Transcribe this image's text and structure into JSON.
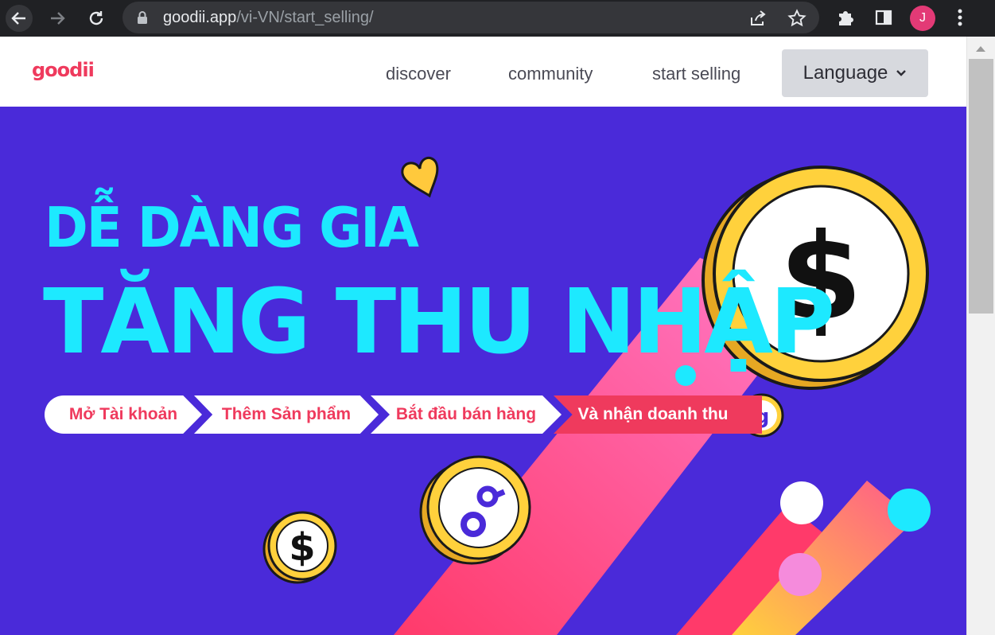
{
  "browser": {
    "url_domain": "goodii.app",
    "url_path": "/vi-VN/start_selling/",
    "profile_initial": "J"
  },
  "header": {
    "logo": "goodii",
    "nav": [
      "discover",
      "community",
      "start selling"
    ],
    "language_label": "Language"
  },
  "hero": {
    "line1": "DỄ DÀNG GIA",
    "line2": "TĂNG THU NHẬP",
    "steps": [
      "Mở Tài khoản",
      "Thêm Sản phẩm",
      "Bắt đầu bán hàng",
      "Và nhận doanh thu"
    ]
  },
  "colors": {
    "hero_bg": "#4a2ad9",
    "headline": "#1de9ff",
    "brand": "#ef3a5d",
    "coin": "#ffd13c"
  }
}
